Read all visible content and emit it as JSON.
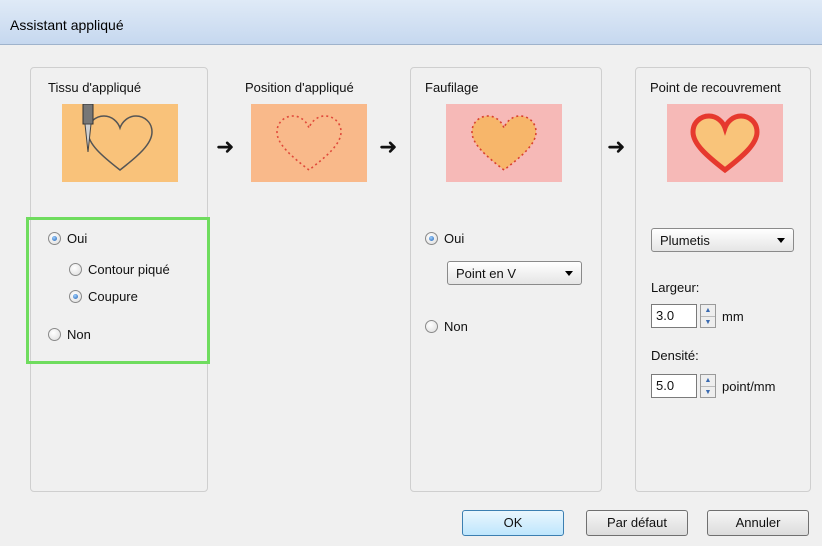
{
  "window": {
    "title": "Assistant appliqué"
  },
  "panels": {
    "tissu": {
      "title": "Tissu d'appliqué"
    },
    "position": {
      "title": "Position d'appliqué"
    },
    "faufilage": {
      "title": "Faufilage"
    },
    "recouvrement": {
      "title": "Point de recouvrement"
    }
  },
  "tissu_options": {
    "oui": "Oui",
    "contour": "Contour piqué",
    "coupure": "Coupure",
    "non": "Non"
  },
  "faufilage_options": {
    "oui": "Oui",
    "type_selected": "Point en V",
    "non": "Non"
  },
  "recouvrement": {
    "type_selected": "Plumetis",
    "largeur_label": "Largeur:",
    "largeur_value": "3.0",
    "largeur_unit": "mm",
    "densite_label": "Densité:",
    "densite_value": "5.0",
    "densite_unit": "point/mm"
  },
  "arrow_glyph": "➜",
  "buttons": {
    "ok": "OK",
    "default": "Par défaut",
    "cancel": "Annuler"
  },
  "colors": {
    "orange_bg": "#f9c27a",
    "peach_bg": "#f9b98a",
    "pink_bg": "#f6b9b7",
    "highlight": "#6fdc5e",
    "heart_red": "#e6392e"
  }
}
